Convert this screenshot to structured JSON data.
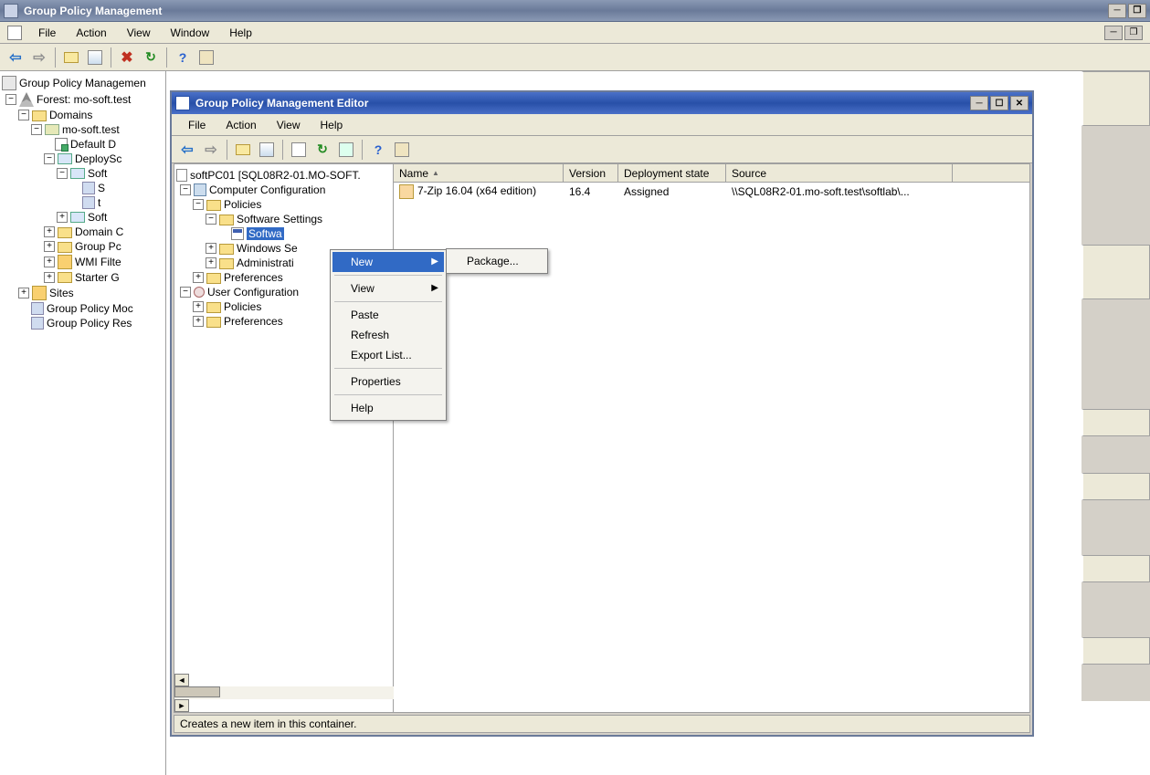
{
  "outer": {
    "title": "Group Policy Management",
    "menus": [
      "File",
      "Action",
      "View",
      "Window",
      "Help"
    ]
  },
  "outer_tree": {
    "root": "Group Policy Managemen",
    "forest": "Forest: mo-soft.test",
    "domains": "Domains",
    "domain": "mo-soft.test",
    "defaultd": "Default D",
    "deploysc": "DeploySc",
    "soft": "Soft",
    "s": "S",
    "t": "t",
    "soft2": "Soft",
    "domainc": "Domain C",
    "grouppc": "Group Pc",
    "wmifilt": "WMI Filte",
    "starterg": "Starter G",
    "sites": "Sites",
    "gpmod": "Group Policy Moc",
    "gpres": "Group Policy Res"
  },
  "editor": {
    "title": "Group Policy Management Editor",
    "menus": [
      "File",
      "Action",
      "View",
      "Help"
    ],
    "root": "softPC01 [SQL08R2-01.MO-SOFT.",
    "compconf": "Computer Configuration",
    "policies": "Policies",
    "swset": "Software Settings",
    "swinst": "Softwa",
    "winset": "Windows Se",
    "admint": "Administrati",
    "prefs": "Preferences",
    "userconf": "User Configuration",
    "upolicies": "Policies",
    "uprefs": "Preferences"
  },
  "cols": {
    "name": "Name",
    "version": "Version",
    "deploy": "Deployment state",
    "source": "Source"
  },
  "row": {
    "name": "7-Zip 16.04 (x64 edition)",
    "version": "16.4",
    "deploy": "Assigned",
    "source": "\\\\SQL08R2-01.mo-soft.test\\softlab\\..."
  },
  "ctx": {
    "new": "New",
    "view": "View",
    "paste": "Paste",
    "refresh": "Refresh",
    "export": "Export List...",
    "props": "Properties",
    "help": "Help",
    "package": "Package..."
  },
  "status": "Creates a new item in this container."
}
